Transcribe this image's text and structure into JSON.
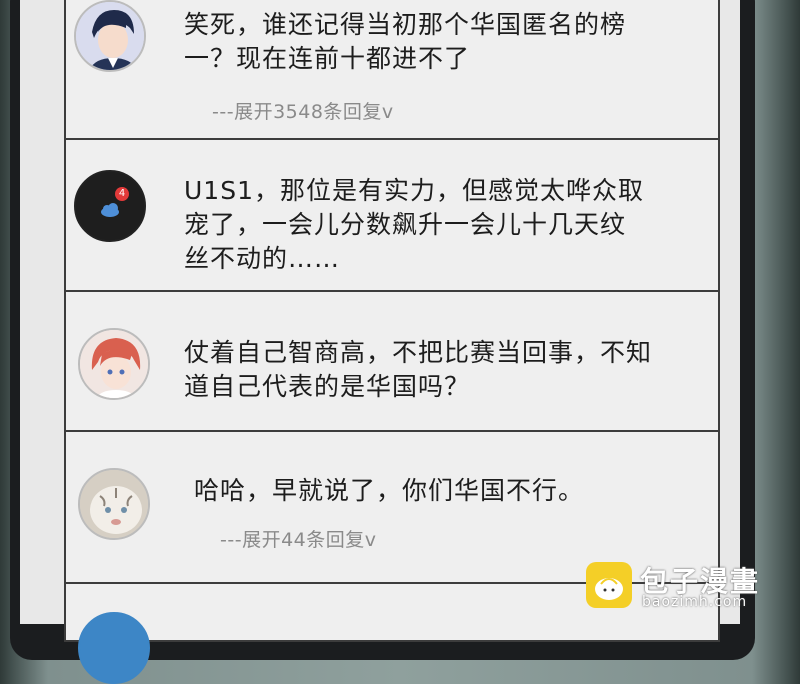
{
  "comments": [
    {
      "lines": [
        "笑死，谁还记得当初那个华国匿名的榜",
        "一？现在连前十都进不了"
      ],
      "replies": "---展开3548条回复v"
    },
    {
      "lines": [
        "U1S1，那位是有实力，但感觉太哗众取",
        "宠了，一会儿分数飙升一会儿十几天纹",
        "丝不动的……"
      ],
      "badge": "4"
    },
    {
      "lines": [
        "仗着自己智商高，不把比赛当回事，不知",
        "道自己代表的是华国吗？"
      ]
    },
    {
      "lines": [
        "哈哈，早就说了，你们华国不行。"
      ],
      "replies": "---展开44条回复v"
    }
  ],
  "watermark": {
    "title": "包子漫畫",
    "url": "baozimh.com"
  },
  "colors": {
    "card_bg": "#efefef",
    "border": "#3c3c3c",
    "reply_text": "#8a8a8a",
    "watermark_yellow": "#f4cf27"
  }
}
